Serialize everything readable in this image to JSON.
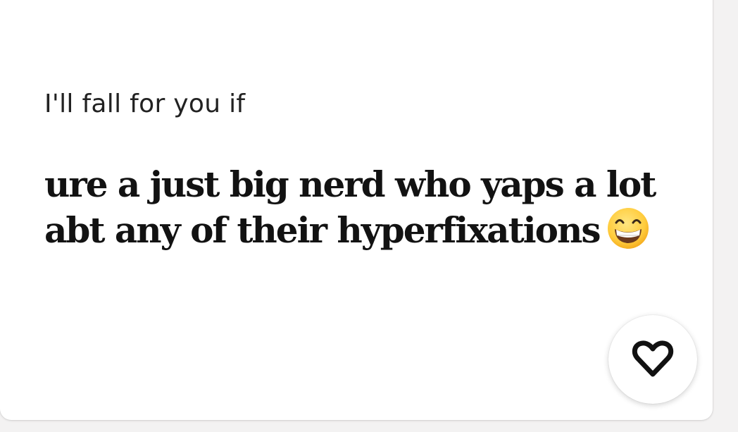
{
  "prompt_card": {
    "prompt": "I'll fall for you if",
    "answer_line_1": "ure a just big nerd who yaps a lot",
    "answer_line_2": "abt any of their hyperfixations",
    "answer_emoji": "grinning-face-emoji"
  },
  "like_button": {
    "icon": "heart-icon"
  },
  "colors": {
    "background": "#f3f2f2",
    "card": "#ffffff",
    "text": "#121212",
    "emoji_face": "#ffcc3d"
  }
}
